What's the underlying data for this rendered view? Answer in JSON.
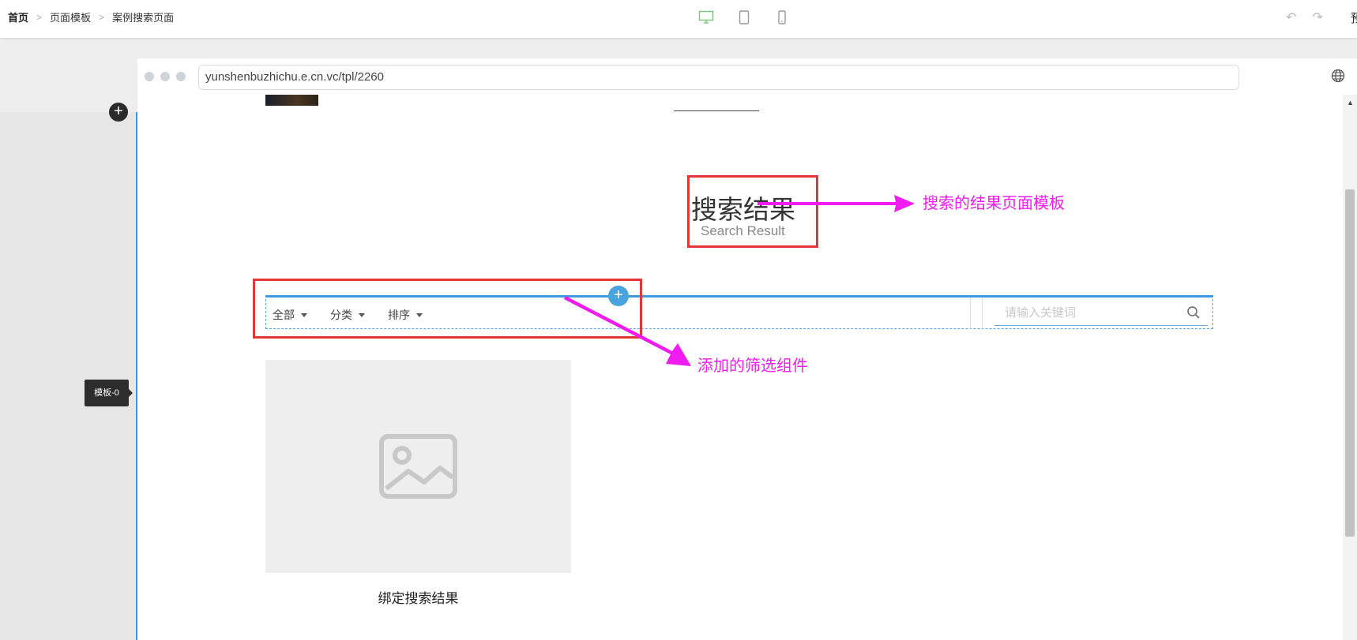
{
  "breadcrumb": {
    "items": [
      "首页",
      "页面模板",
      "案例搜索页面"
    ],
    "separator": ">"
  },
  "device_switch": {
    "items": [
      {
        "name": "desktop",
        "active": true
      },
      {
        "name": "tablet",
        "active": false
      },
      {
        "name": "mobile",
        "active": false
      }
    ]
  },
  "toolbar": {
    "undo": "↶",
    "redo": "↷",
    "edge_char": "预"
  },
  "left_panel": {
    "add": "+",
    "template_tag": "模板-0"
  },
  "browser": {
    "url": "yunshenbuzhichu.e.cn.vc/tpl/2260",
    "scroll_up": "▲"
  },
  "page": {
    "title_cn": "搜索结果",
    "title_en": "Search Result",
    "add_component": "+",
    "filters": [
      {
        "label": "全部"
      },
      {
        "label": "分类"
      },
      {
        "label": "排序"
      }
    ],
    "search": {
      "placeholder": "请输入关键词",
      "value": ""
    },
    "card": {
      "caption": "绑定搜索结果"
    }
  },
  "annotations": {
    "note_1": "搜索的结果页面模板",
    "note_2": "添加的筛选组件",
    "color": "#ef1bef",
    "highlight_color": "#e53535"
  },
  "colors": {
    "accent": "#3b96e4",
    "device_active": "#7bc67b"
  }
}
